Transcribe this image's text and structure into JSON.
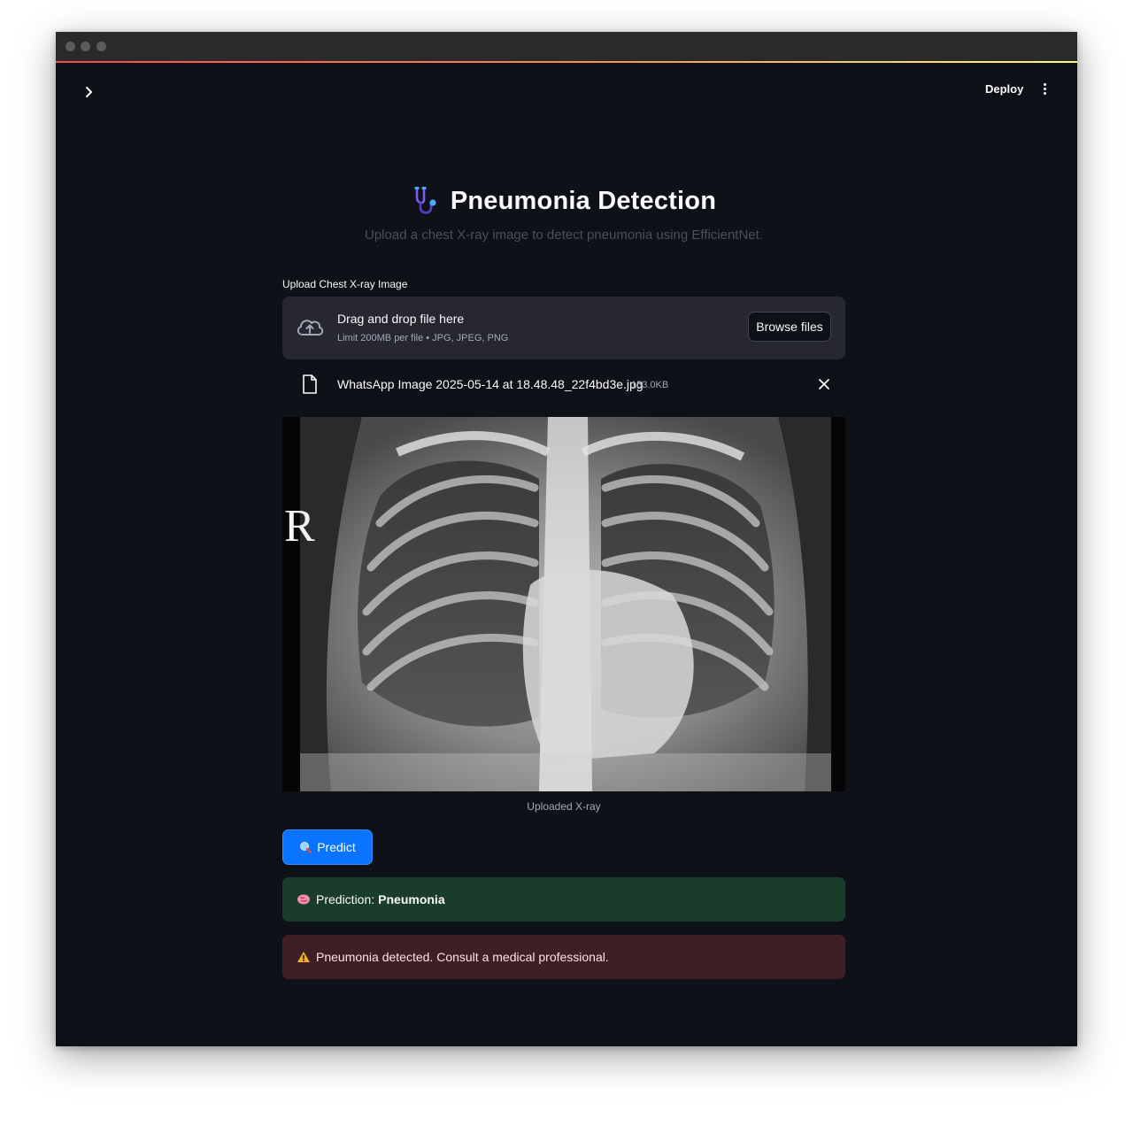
{
  "header": {
    "deploy_label": "Deploy"
  },
  "page": {
    "title": "Pneumonia Detection",
    "subtitle": "Upload a chest X-ray image to detect pneumonia using EfficientNet."
  },
  "uploader": {
    "label": "Upload Chest X-ray Image",
    "drag_text": "Drag and drop file here",
    "limit_text": "Limit 200MB per file • JPG, JPEG, PNG",
    "browse_label": "Browse files",
    "file_name": "WhatsApp Image 2025-05-14 at 18.48.48_22f4bd3e.jpg",
    "file_size": "153.0KB"
  },
  "image": {
    "caption": "Uploaded X-ray",
    "marker": "R"
  },
  "predict_button": {
    "label": "Predict",
    "icon": "magnifier-icon"
  },
  "result": {
    "prefix": "Prediction:",
    "value": "Pneumonia",
    "icon": "brain-icon"
  },
  "warning": {
    "text": "Pneumonia detected. Consult a medical professional.",
    "icon": "warning-icon"
  },
  "colors": {
    "background": "#0e1117",
    "primary": "#0b74ff",
    "success_bg": "#1a3d2b",
    "error_bg": "#3f1f26",
    "accent_gradient_start": "#ff4b4b",
    "accent_gradient_end": "#fffd80"
  }
}
